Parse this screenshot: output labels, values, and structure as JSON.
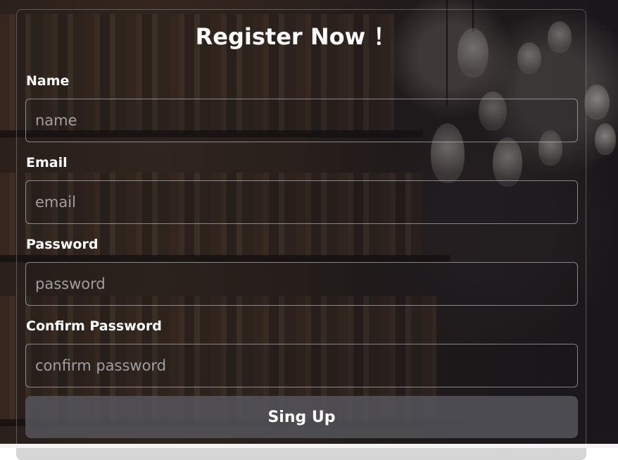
{
  "form": {
    "title": "Register Now ！",
    "fields": [
      {
        "label": "Name",
        "placeholder": "name",
        "value": ""
      },
      {
        "label": "Email",
        "placeholder": "email",
        "value": ""
      },
      {
        "label": "Password",
        "placeholder": "password",
        "value": ""
      },
      {
        "label": "Confirm Password",
        "placeholder": "confirm password",
        "value": ""
      }
    ],
    "submit_label": "Sing Up"
  },
  "colors": {
    "text": "#ffffff",
    "button_bg": "#55555a",
    "placeholder": "#c8c8cd"
  }
}
